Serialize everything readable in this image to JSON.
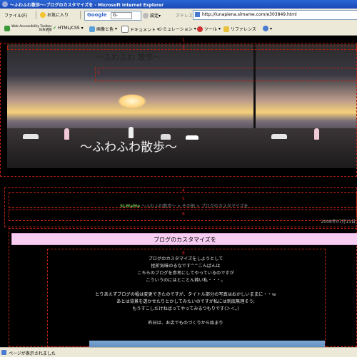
{
  "window": {
    "title": "〜ふわふわ散歩〜-ブログのカスタマイズを - Microsoft Internet Explorer"
  },
  "toolbar1": {
    "file": "ファイル(F)",
    "favorites": "お気に入り",
    "google_brand": "Google",
    "google_query": "G-",
    "settings": "設定▾",
    "address_label": "アドレス(D)",
    "address_url": "http://lunapiena.slmame.com/e303849.html"
  },
  "toolbar2": {
    "accessibility": "Web Accessibility Toolbar",
    "lang": "日本語版",
    "html_css": "HTML/CSS",
    "images_colors": "画像と色",
    "document": "ドキュメント",
    "simulation": "シミュレーション",
    "tools": "ツール",
    "reference": "リファレンス"
  },
  "page": {
    "header_title_small": "〜ふわふわ 散歩〜",
    "header_title_large": "〜ふわふわ散歩〜",
    "markers": [
      "1",
      "2",
      "3",
      "4",
      "5",
      "6",
      "7",
      "8"
    ],
    "breadcrumb_brand": "SLMaMe",
    "breadcrumb": "〜ふわふわ散歩〜 > その他 > ブログのカスタマイズを",
    "date": "2008年07月13日",
    "entry_title": "ブログのカスタマイズを",
    "body_lines": [
      "ブログのカスタマイズをしようとして",
      "挫折気味のるなです^^こんばんは",
      "こちらのブログを参考にしてやっているのですが",
      "こういうのにはとことん鈍い私・・・。",
      "",
      "とりあえずブログの幅は変更できたのですが、タイトル部分の写真はおかしいままに・・ｗ",
      "あとは背景を透かせたりとかしてみたいのですが私には到底無理そう;",
      "もうすこしだけねばってやってみるつもりです(＞＜。)",
      "",
      "昨日は、お店でものづくりから始まり"
    ]
  },
  "status": {
    "text": "ページが表示されました"
  }
}
